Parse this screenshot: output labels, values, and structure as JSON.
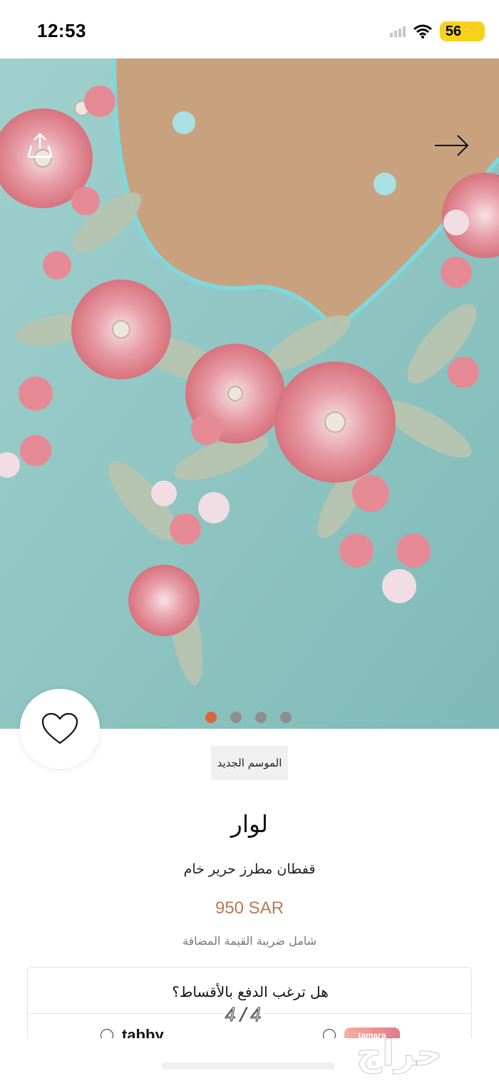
{
  "status_bar": {
    "time": "12:53",
    "battery": "56"
  },
  "gallery": {
    "image_alt": "قفطان مطرز حرير خام",
    "slide_count": 4,
    "active_slide": 1,
    "counter": "4 / 4"
  },
  "product": {
    "badge": "الموسم الجديد",
    "brand": "لوار",
    "name": "قفطان مطرز حرير خام",
    "price": "950 SAR",
    "vat_note": "شامل ضريبة القيمة المضافة"
  },
  "installments": {
    "title": "هل ترغب الدفع بالأقساط؟",
    "providers": [
      "tabby",
      "tamara"
    ]
  },
  "watermark": "حراج",
  "colors": {
    "price": "#b87a55",
    "active_dot": "#d9663a",
    "battery": "#f7d21c",
    "fabric": "#8fc8c6"
  }
}
